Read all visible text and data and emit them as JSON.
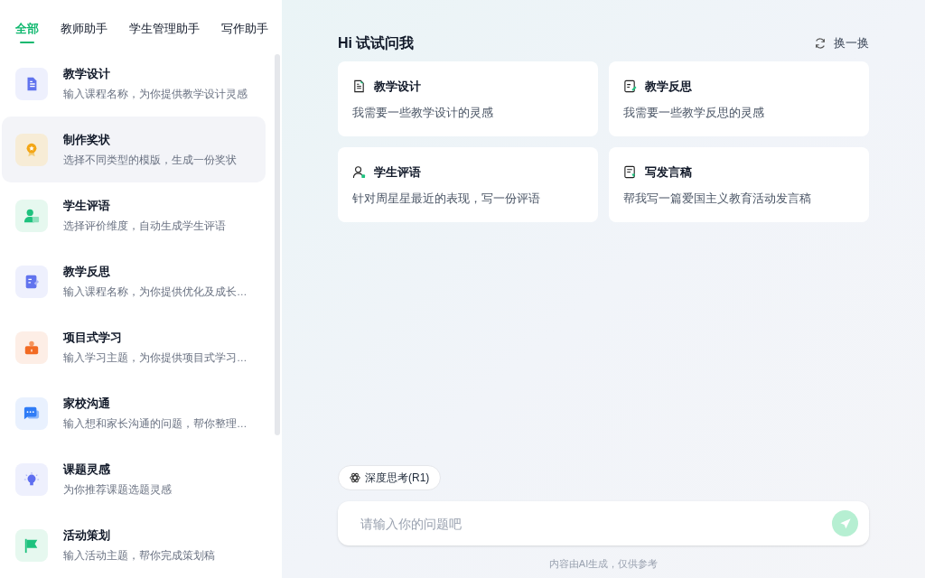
{
  "tabs": [
    {
      "label": "全部",
      "selected": true
    },
    {
      "label": "教师助手",
      "selected": false
    },
    {
      "label": "学生管理助手",
      "selected": false
    },
    {
      "label": "写作助手",
      "selected": false
    }
  ],
  "sidebar": {
    "items": [
      {
        "kind": "document",
        "title": "教学设计",
        "description": "输入课程名称，为你提供教学设计灵感",
        "selected": false
      },
      {
        "kind": "award",
        "title": "制作奖状",
        "description": "选择不同类型的模版，生成一份奖状",
        "selected": true
      },
      {
        "kind": "student",
        "title": "学生评语",
        "description": "选择评价维度，自动生成学生评语",
        "selected": false
      },
      {
        "kind": "reflection",
        "title": "教学反思",
        "description": "输入课程名称，为你提供优化及成长…",
        "selected": false
      },
      {
        "kind": "project",
        "title": "项目式学习",
        "description": "输入学习主题，为你提供项目式学习…",
        "selected": false
      },
      {
        "kind": "chat",
        "title": "家校沟通",
        "description": "输入想和家长沟通的问题，帮你整理…",
        "selected": false
      },
      {
        "kind": "idea",
        "title": "课题灵感",
        "description": "为你推荐课题选题灵感",
        "selected": false
      },
      {
        "kind": "flag",
        "title": "活动策划",
        "description": "输入活动主题，帮你完成策划稿",
        "selected": false
      }
    ]
  },
  "main": {
    "heading": "Hi 试试问我",
    "refresh_label": "换一换",
    "suggestions": [
      {
        "kind": "document",
        "title": "教学设计",
        "prompt": "我需要一些教学设计的灵感"
      },
      {
        "kind": "reflection",
        "title": "教学反思",
        "prompt": "我需要一些教学反思的灵感"
      },
      {
        "kind": "student",
        "title": "学生评语",
        "prompt": "针对周星星最近的表现，写一份评语"
      },
      {
        "kind": "speech",
        "title": "写发言稿",
        "prompt": "帮我写一篇爱国主义教育活动发言稿"
      }
    ],
    "deep_think_label": "深度思考(R1)",
    "input": {
      "placeholder": "请输入你的问题吧"
    },
    "send_disabled": true,
    "disclaimer": "内容由AI生成，仅供参考"
  }
}
